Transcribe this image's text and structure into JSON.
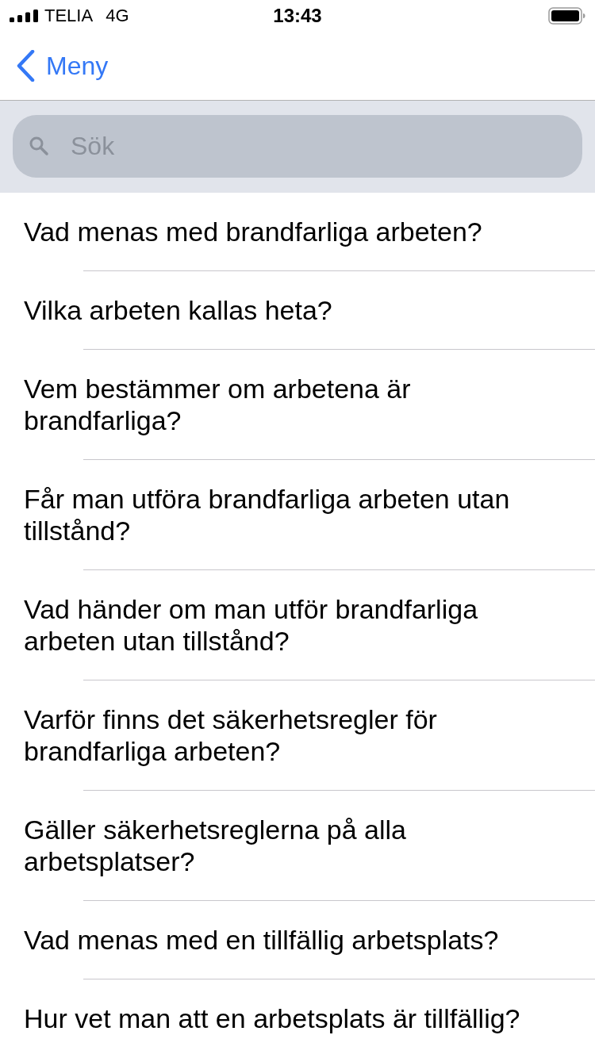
{
  "status_bar": {
    "carrier": "TELIA",
    "network": "4G",
    "time": "13:43"
  },
  "nav_bar": {
    "back_label": "Meny"
  },
  "search": {
    "placeholder": "Sök"
  },
  "questions": [
    "Vad menas med brandfarliga arbeten?",
    "Vilka arbeten kallas heta?",
    "Vem bestämmer om arbetena är brandfarliga?",
    "Får man utföra brandfarliga arbeten utan tillstånd?",
    "Vad händer om man utför brandfarliga arbeten utan tillstånd?",
    "Varför finns det säkerhetsregler för brandfarliga arbeten?",
    "Gäller säkerhetsreglerna på alla arbetsplatser?",
    "Vad menas med en tillfällig arbetsplats?",
    "Hur vet man att en arbetsplats är tillfällig?"
  ]
}
